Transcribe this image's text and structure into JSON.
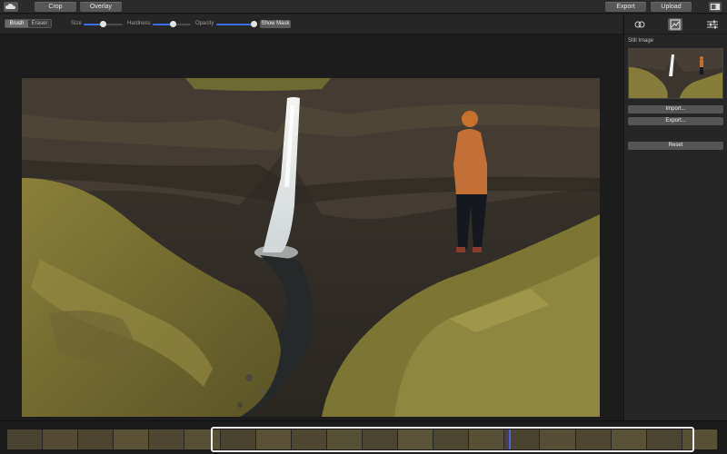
{
  "topbar": {
    "crop_label": "Crop",
    "overlay_label": "Overlay",
    "export_label": "Export",
    "upload_label": "Upload"
  },
  "toolbar": {
    "brush_label": "Brush",
    "eraser_label": "Eraser",
    "size_label": "Size",
    "hardness_label": "Hardness",
    "opacity_label": "Opacity",
    "show_mask_label": "Show Mask",
    "size_value": 0.45,
    "hardness_value": 0.55,
    "opacity_value": 0.95
  },
  "sidebar": {
    "section_label": "Still Image",
    "import_label": "Import...",
    "export_label": "Export...",
    "reset_label": "Reset"
  },
  "colors": {
    "accent": "#3b6ee0",
    "background": "#1f1f1f",
    "button": "#575757"
  },
  "icons": {
    "app": "cloud-icon",
    "sidebar_toggle": "sidebar-toggle-icon",
    "tab1": "link-loop-icon",
    "tab2": "image-layers-icon",
    "tab3": "sliders-icon"
  }
}
